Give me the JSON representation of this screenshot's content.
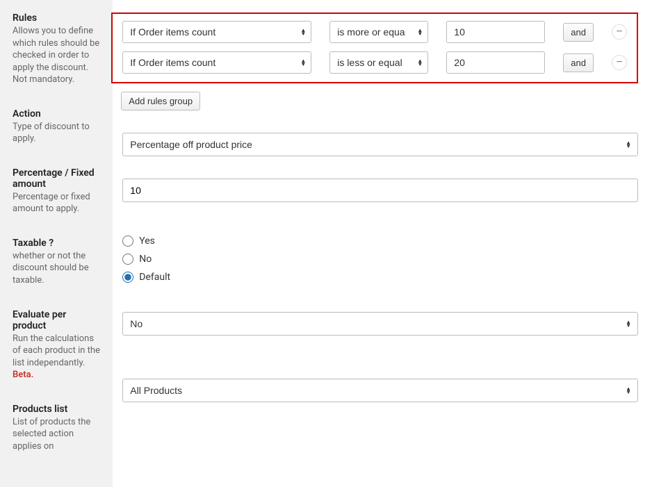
{
  "sidebar": {
    "rules": {
      "title": "Rules",
      "desc": "Allows you to define which rules should be checked in order to apply the discount. Not mandatory."
    },
    "action": {
      "title": "Action",
      "desc": "Type of discount to apply."
    },
    "percentage": {
      "title": "Percentage / Fixed amount",
      "desc": "Percentage or fixed amount to apply."
    },
    "taxable": {
      "title": "Taxable ?",
      "desc": "whether or not the discount should be taxable."
    },
    "evaluate": {
      "title": "Evaluate per product",
      "desc": "Run the calculations of each product in the list independantly.",
      "beta": "Beta."
    },
    "products": {
      "title": "Products list",
      "desc": "List of products the selected action applies on"
    }
  },
  "rules": {
    "rows": [
      {
        "cond": "If Order items count",
        "op": "is more or equa",
        "val": "10",
        "join": "and"
      },
      {
        "cond": "If Order items count",
        "op": "is less or equal",
        "val": "20",
        "join": "and"
      }
    ],
    "add_label": "Add rules group"
  },
  "action": {
    "value": "Percentage off product price"
  },
  "percentage": {
    "value": "10"
  },
  "taxable": {
    "opts": {
      "yes": "Yes",
      "no": "No",
      "default": "Default"
    },
    "selected": "default"
  },
  "evaluate": {
    "value": "No"
  },
  "products": {
    "value": "All Products"
  },
  "icons": {
    "minus": "−"
  }
}
